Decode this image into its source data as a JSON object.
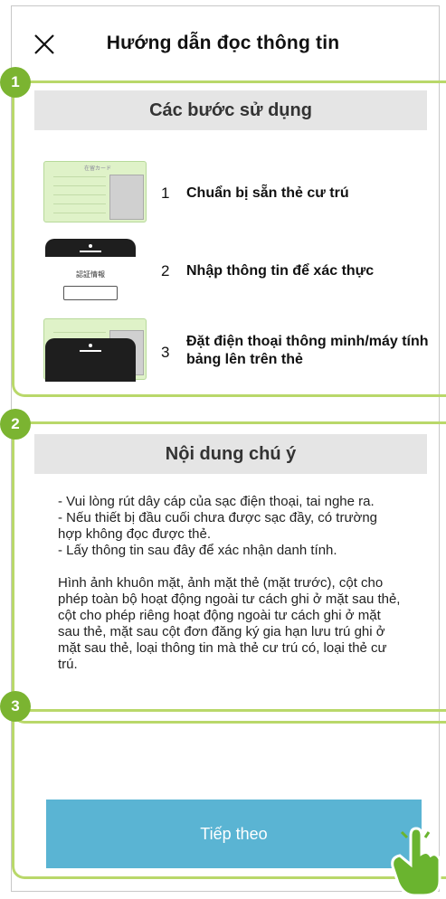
{
  "header": {
    "title": "Hướng dẫn đọc thông tin",
    "close_icon": "close-icon"
  },
  "section1": {
    "badge": "1",
    "title": "Các bước sử dụng",
    "steps": [
      {
        "num": "1",
        "text": "Chuẩn bị sẵn thẻ cư trú",
        "icon": "residence-card-icon"
      },
      {
        "num": "2",
        "text": "Nhập thông tin để xác thực",
        "icon": "phone-input-icon"
      },
      {
        "num": "3",
        "text": "Đặt điện thoại thông minh/máy tính bảng lên trên thẻ",
        "icon": "phone-on-card-icon"
      }
    ],
    "card_label": "在留カード",
    "phone_label": "認証情報"
  },
  "section2": {
    "badge": "2",
    "title": "Nội dung chú ý",
    "notes": "- Vui lòng rút dây cáp của sạc điện thoại, tai nghe ra.\n - Nếu thiết bị đầu cuối chưa được sạc đầy, có trường hợp không đọc được thẻ.\n - Lấy thông tin sau đây để xác nhận danh tính.\n\n Hình ảnh khuôn mặt, ảnh mặt thẻ (mặt trước), cột cho phép toàn bộ hoạt động ngoài tư cách ghi ở mặt sau thẻ, cột cho phép riêng hoạt động ngoài tư cách ghi ở mặt sau thẻ, mặt sau cột đơn đăng ký gia hạn lưu trú ghi ở mặt sau thẻ, loại thông tin mà thẻ cư trú có, loại thẻ cư trú."
  },
  "section3": {
    "badge": "3",
    "next_label": "Tiếp theo",
    "hand_icon": "tap-hand-icon"
  },
  "colors": {
    "bracket": "#b9d86a",
    "badge": "#7bb431",
    "button": "#5ab4d3",
    "header_bg": "#e5e5e5"
  }
}
